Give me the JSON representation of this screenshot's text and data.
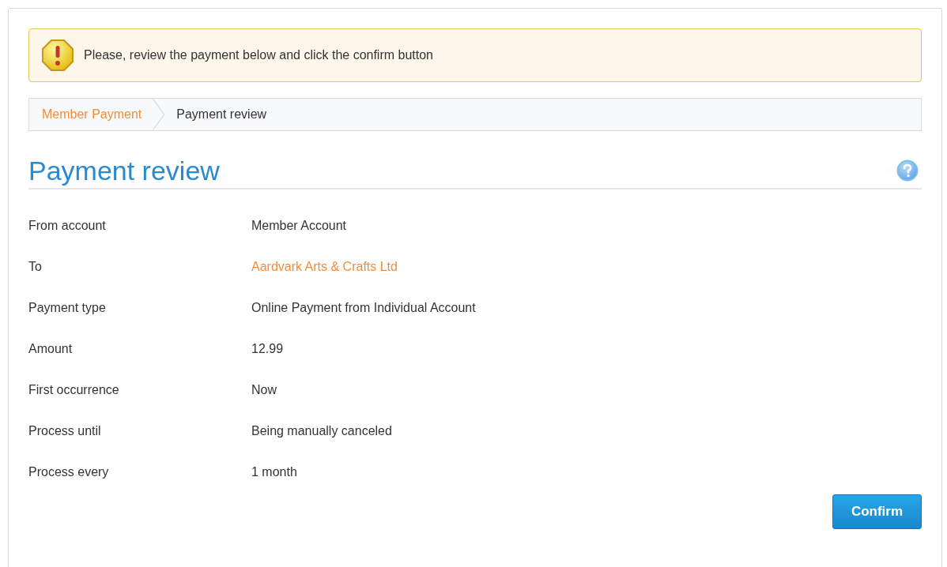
{
  "notice": {
    "text": "Please, review the payment below and click the confirm button"
  },
  "breadcrumb": [
    {
      "label": "Member Payment",
      "kind": "link"
    },
    {
      "label": "Payment review",
      "kind": "current"
    }
  ],
  "heading": "Payment review",
  "fields": [
    {
      "label": "From account",
      "value": "Member Account",
      "kind": "text"
    },
    {
      "label": "To",
      "value": "Aardvark Arts & Crafts Ltd",
      "kind": "link"
    },
    {
      "label": "Payment type",
      "value": "Online Payment from Individual Account",
      "kind": "text"
    },
    {
      "label": "Amount",
      "value": "12.99",
      "kind": "text"
    },
    {
      "label": "First occurrence",
      "value": "Now",
      "kind": "text"
    },
    {
      "label": "Process until",
      "value": "Being manually canceled",
      "kind": "text"
    },
    {
      "label": "Process every",
      "value": "1 month",
      "kind": "text"
    }
  ],
  "buttons": [
    "Confirm"
  ]
}
